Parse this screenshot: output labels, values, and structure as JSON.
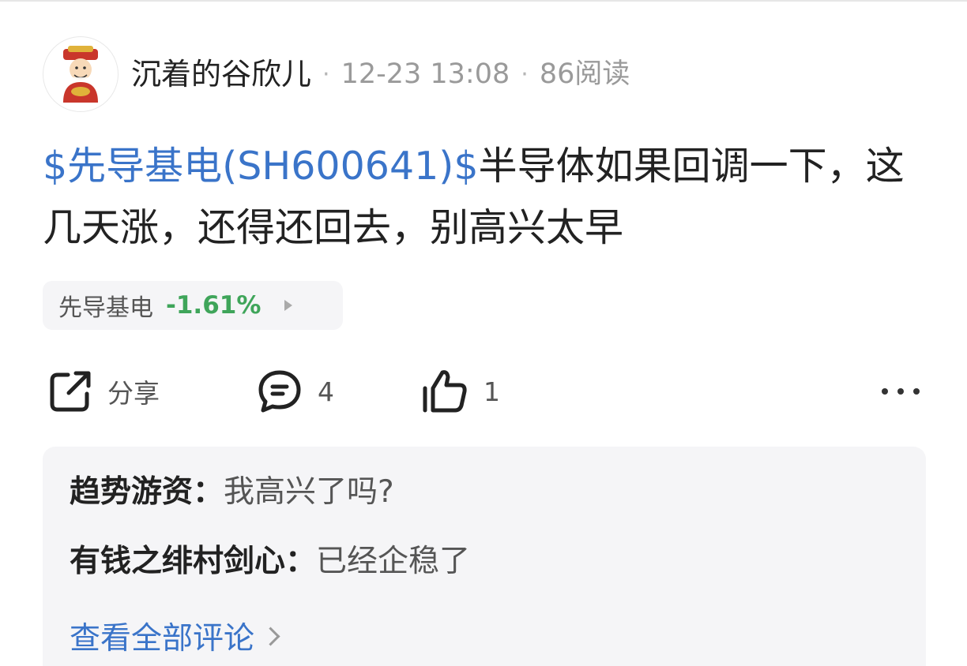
{
  "author": {
    "name": "沉着的谷欣儿",
    "timestamp": "12-23 13:08",
    "reads": "86阅读",
    "separator": "·",
    "avatar_icon": "fortune-god-avatar"
  },
  "post": {
    "stock_link": "$先导基电(SH600641)$",
    "body": "半导体如果回调一下，这几天涨，还得还回去，别高兴太早"
  },
  "stock_chip": {
    "name": "先导基电",
    "change": "-1.61%",
    "change_color": "#3fa55a"
  },
  "actions": {
    "share_label": "分享",
    "comment_count": "4",
    "like_count": "1"
  },
  "comments": {
    "items": [
      {
        "user": "趋势游资",
        "colon": "：",
        "text": "我高兴了吗?"
      },
      {
        "user": "有钱之绯村剑心",
        "colon": "：",
        "text": "已经企稳了"
      }
    ],
    "view_all_label": "查看全部评论"
  },
  "colors": {
    "link": "#3a74c9",
    "text": "#222222",
    "muted": "#9a9a9a",
    "box_bg": "#f5f5f7"
  }
}
